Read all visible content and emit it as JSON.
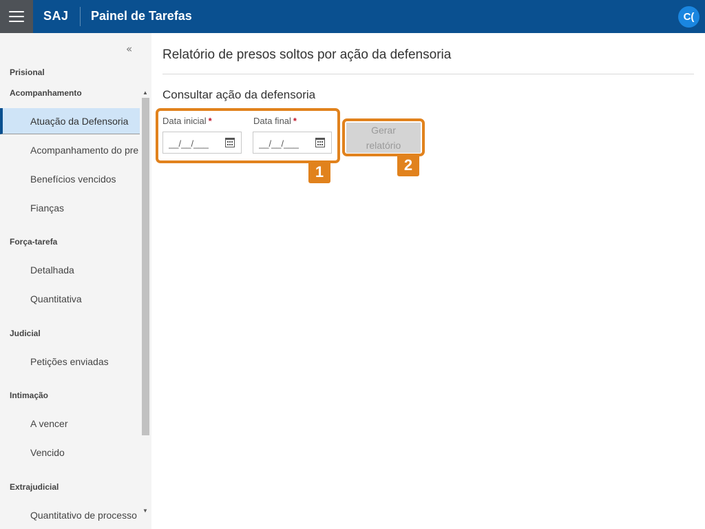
{
  "header": {
    "brand": "SAJ",
    "title": "Painel de Tarefas",
    "avatar_initials": "C("
  },
  "sidebar": {
    "collapse_glyph": "«",
    "groups": [
      {
        "label": "Prisional"
      },
      {
        "label": "Acompanhamento",
        "items": [
          "Atuação da Defensoria",
          "Acompanhamento do pre",
          "Benefícios vencidos",
          "Fianças"
        ]
      },
      {
        "label": "Força-tarefa",
        "items": [
          "Detalhada",
          "Quantitativa"
        ]
      },
      {
        "label": "Judicial",
        "items": [
          "Petições enviadas"
        ]
      },
      {
        "label": "Intimação",
        "items": [
          "A vencer",
          "Vencido"
        ]
      },
      {
        "label": "Extrajudicial",
        "items": [
          "Quantitativo de processo"
        ]
      }
    ],
    "active_item": "Atuação da Defensoria"
  },
  "main": {
    "page_title": "Relatório de presos soltos por ação da defensoria",
    "section_title": "Consultar ação da defensoria",
    "start_date": {
      "label": "Data inicial",
      "required_mark": "*",
      "value": "__/__/___"
    },
    "end_date": {
      "label": "Data final",
      "required_mark": "*",
      "value": "__/__/___"
    },
    "generate_button": {
      "line1": "Gerar",
      "line2": "relatório"
    }
  },
  "annotations": {
    "badge_1": "1",
    "badge_2": "2",
    "color": "#e1821d"
  },
  "colors": {
    "topbar": "#0a5090",
    "menu_button": "#4e5257",
    "avatar": "#1a86e0",
    "sidebar": "#f4f4f4",
    "active_item": "#cfe4f7"
  }
}
